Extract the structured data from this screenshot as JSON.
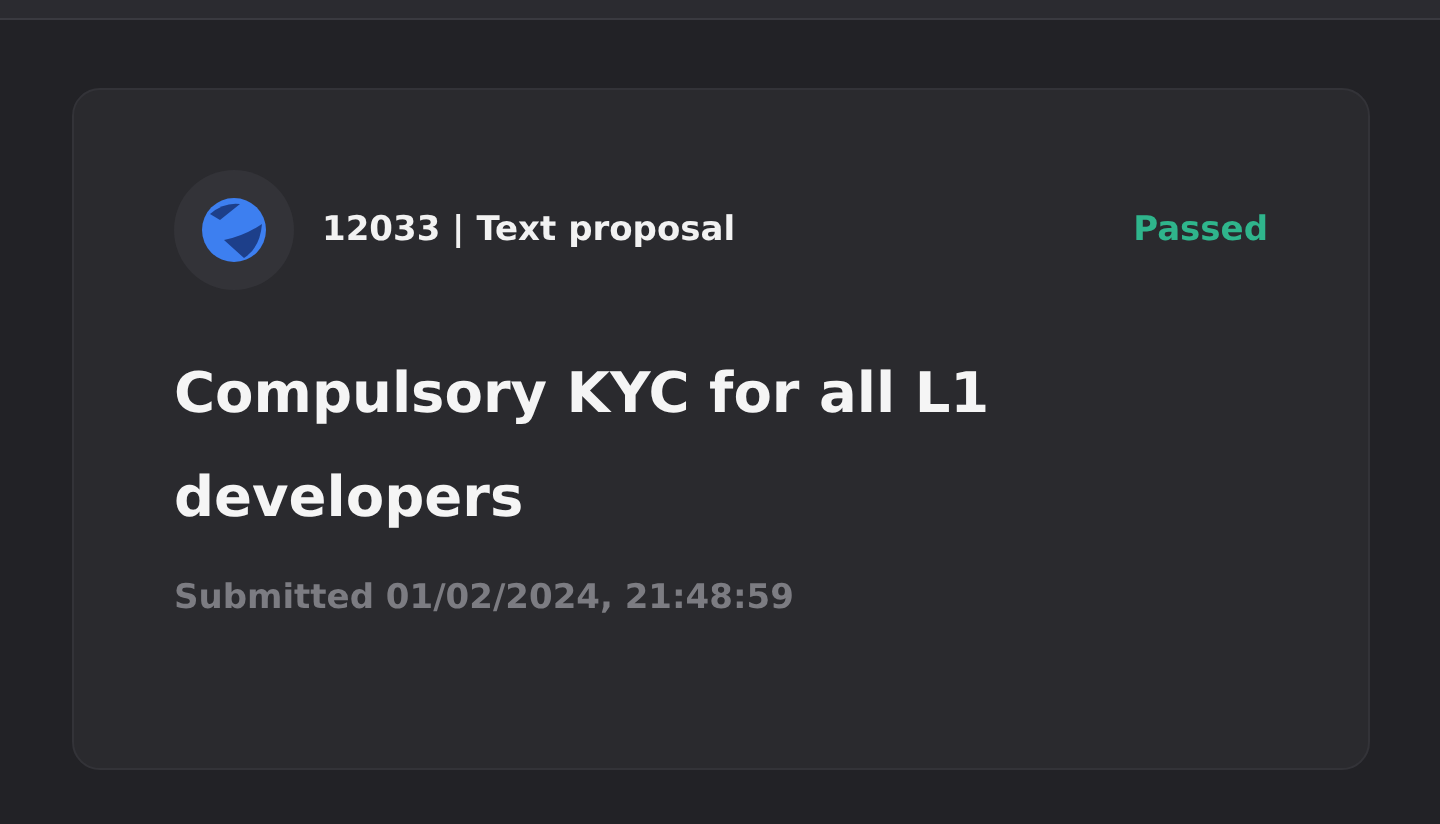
{
  "proposal": {
    "id_and_type": "12033 | Text proposal",
    "status": "Passed",
    "title": "Compulsory KYC for all L1 developers",
    "submitted": "Submitted 01/02/2024, 21:48:59"
  }
}
